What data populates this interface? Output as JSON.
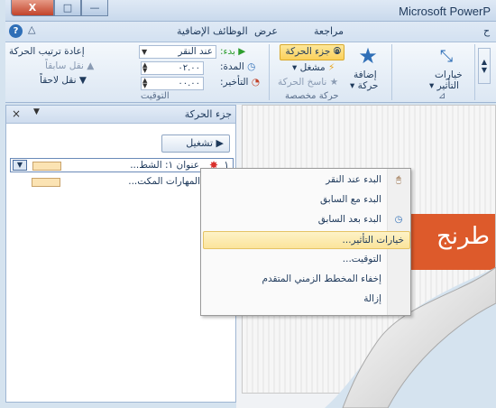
{
  "window": {
    "app_title": "Microsoft PowerP",
    "close_label": "X",
    "maximize_label": "□",
    "minimize_label": "—"
  },
  "tabs": {
    "help_label": "?",
    "minimize_ribbon_label": "△",
    "addins": "الوظائف الإضافية",
    "view": "عرض",
    "review": "مراجعة",
    "cut": "ح"
  },
  "ribbon": {
    "reorder_title": "إعادة ترتيب الحركة",
    "move_earlier": "▲ نقل سابقاً",
    "move_later": "▼ نقل لاحقاً",
    "start_label": "▶ بدء:",
    "start_value": "عند النقر",
    "duration_label": "المدة:",
    "duration_value": "٠٢.٠٠",
    "delay_label": "التأخير:",
    "delay_value": "٠٠.٠٠",
    "timing_group": "التوقيت",
    "animation_pane_btn": "جزء الحركة",
    "trigger_btn": "مشغل ▾",
    "painter_btn": "ناسخ الحركة",
    "advanced_group": "حركة مخصصة",
    "add_animation": "إضافة",
    "add_animation2": "حركة ▾",
    "effect_options": "خيارات",
    "effect_options2": "التأثير ▾"
  },
  "pane": {
    "title": "جزء الحركة",
    "close": "×",
    "dropdown": "▼",
    "play": "▶ تشغيل",
    "items": [
      {
        "num": "١",
        "text": "عنوان ١: الشط...",
        "star_color": "#d9302c"
      },
      {
        "num": "٢",
        "text": "المهارات المكت...",
        "star_color": "#2f8a2f"
      }
    ]
  },
  "slide": {
    "title_text": "طرنج"
  },
  "menu": {
    "items": [
      {
        "label": "البدء عند النقر",
        "icon": "mouse-click-icon"
      },
      {
        "label": "البدء مع السابق",
        "icon": ""
      },
      {
        "label": "البدء بعد السابق",
        "icon": "clock-icon"
      },
      {
        "label": "خيارات التأثير...",
        "icon": ""
      },
      {
        "label": "التوقيت...",
        "icon": ""
      },
      {
        "label": "إخفاء المخطط الزمني المتقدم",
        "icon": ""
      },
      {
        "label": "إزالة",
        "icon": ""
      }
    ],
    "highlighted_index": 3
  }
}
